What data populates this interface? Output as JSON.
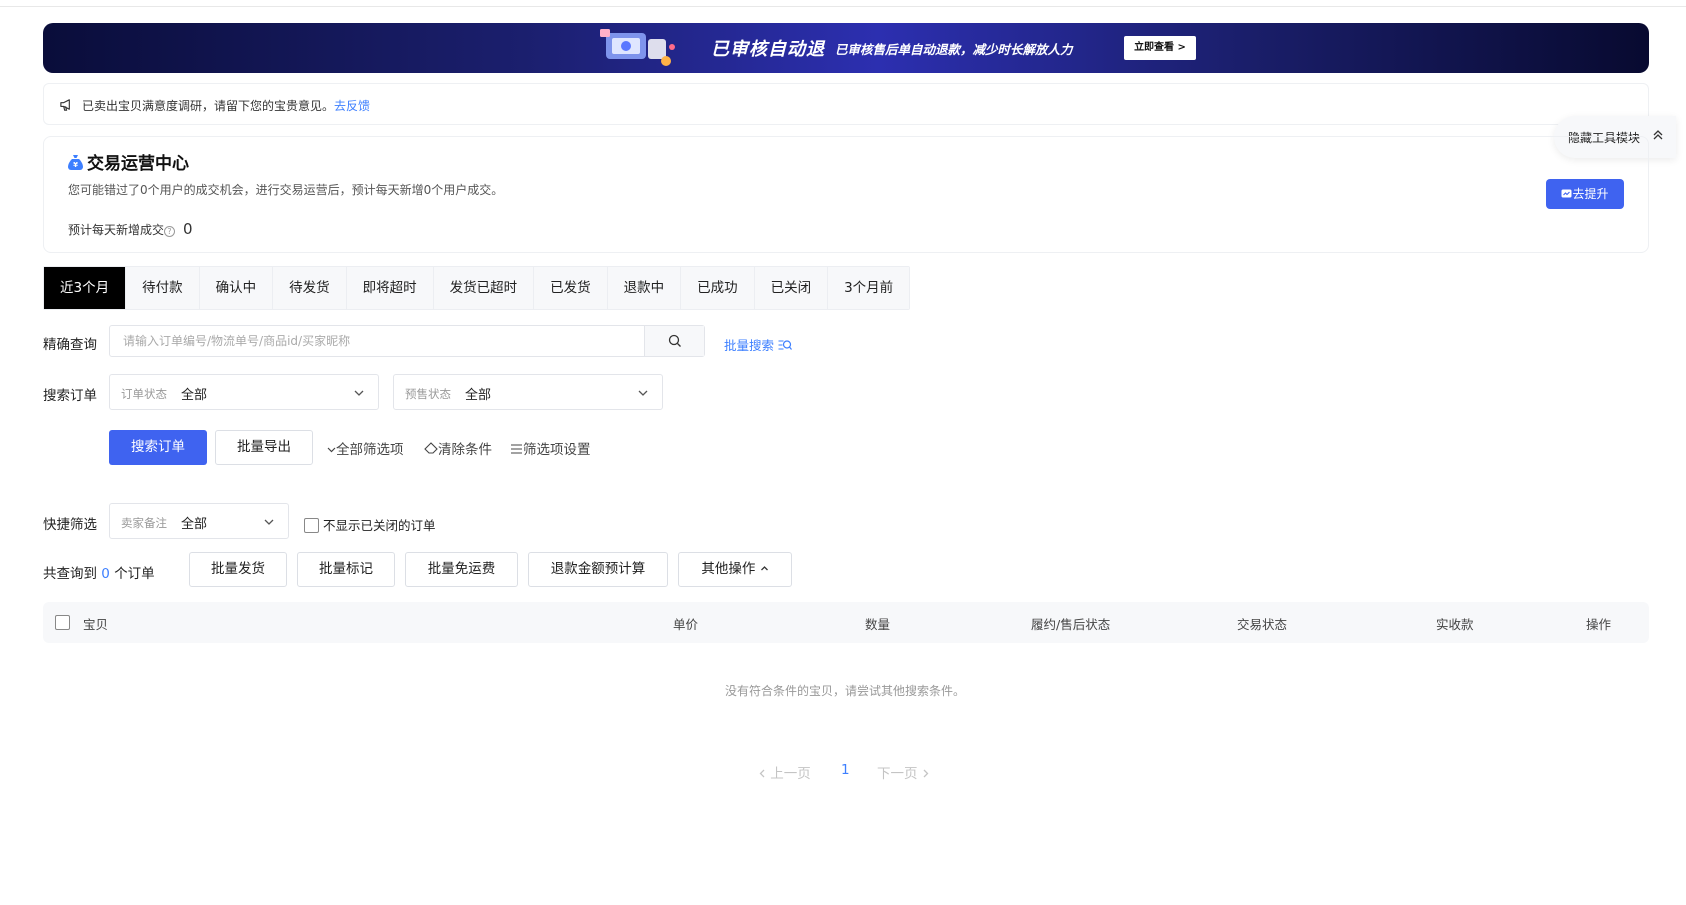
{
  "banner": {
    "title": "已审核自动退",
    "subtitle": "已审核售后单自动退款，减少时长解放人力",
    "cta": "立即查看 >"
  },
  "notice": {
    "text": "已卖出宝贝满意度调研，请留下您的宝贵意见。",
    "link": "去反馈"
  },
  "tools_toggle": {
    "label": "隐藏工具模块"
  },
  "operations_card": {
    "title": "交易运营中心",
    "description": "您可能错过了0个用户的成交机会，进行交易运营后，预计每天新增0个用户成交。",
    "estimate_label": "预计每天新增成交",
    "estimate_help": "?",
    "estimate_value": "0",
    "button": "去提升"
  },
  "status_tabs": [
    {
      "label": "近3个月",
      "active": true
    },
    {
      "label": "待付款"
    },
    {
      "label": "确认中"
    },
    {
      "label": "待发货"
    },
    {
      "label": "即将超时"
    },
    {
      "label": "发货已超时"
    },
    {
      "label": "已发货"
    },
    {
      "label": "退款中"
    },
    {
      "label": "已成功"
    },
    {
      "label": "已关闭"
    },
    {
      "label": "3个月前"
    }
  ],
  "precise_search": {
    "label": "精确查询",
    "placeholder": "请输入订单编号/物流单号/商品id/买家昵称",
    "batch_link": "批量搜索"
  },
  "search_orders": {
    "label": "搜索订单",
    "order_status": {
      "prefix": "订单状态",
      "value": "全部"
    },
    "presale_status": {
      "prefix": "预售状态",
      "value": "全部"
    },
    "search_button": "搜索订单",
    "export_button": "批量导出",
    "all_filters": "全部筛选项",
    "clear": "清除条件",
    "filter_settings": "筛选项设置"
  },
  "quick_filter": {
    "label": "快捷筛选",
    "seller_note": {
      "prefix": "卖家备注",
      "value": "全部"
    },
    "hide_closed": "不显示已关闭的订单"
  },
  "results": {
    "prefix": "共查询到",
    "count": "0",
    "suffix": "个订单",
    "actions": [
      "批量发货",
      "批量标记",
      "批量免运费",
      "退款金额预计算",
      "其他操作"
    ]
  },
  "table": {
    "columns": [
      "宝贝",
      "单价",
      "数量",
      "履约/售后状态",
      "交易状态",
      "实收款",
      "操作"
    ],
    "empty_text": "没有符合条件的宝贝，请尝试其他搜索条件。"
  },
  "pagination": {
    "prev": "上一页",
    "current": "1",
    "next": "下一页"
  },
  "colors": {
    "primary": "#3f63f0",
    "link": "#3d7fff",
    "active_tab": "#000000",
    "banner_bg": "#1b1f6e"
  }
}
